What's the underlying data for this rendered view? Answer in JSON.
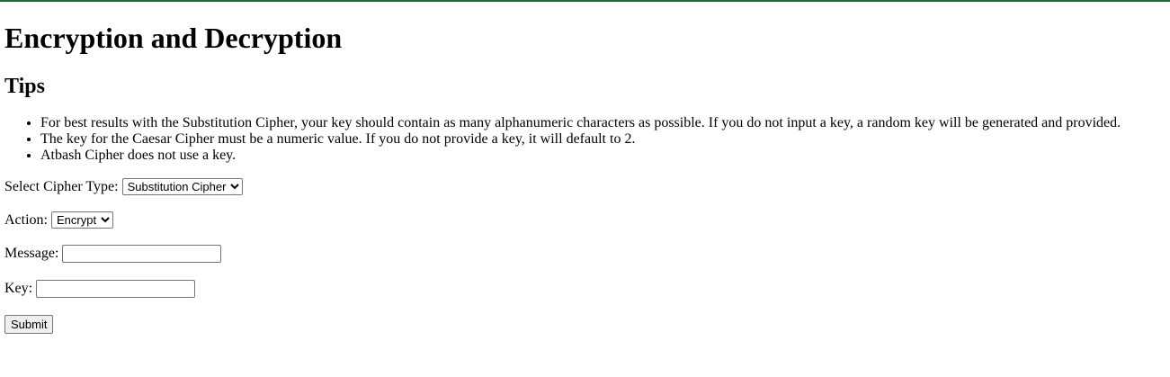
{
  "page": {
    "title": "Encryption and Decryption",
    "tips_heading": "Tips",
    "tips": [
      "For best results with the Substitution Cipher, your key should contain as many alphanumeric characters as possible. If you do not input a key, a random key will be generated and provided.",
      "The key for the Caesar Cipher must be a numeric value. If you do not provide a key, it will default to 2.",
      "Atbash Cipher does not use a key."
    ],
    "accent_color": "#1f6b3a"
  },
  "form": {
    "cipher_label": "Select Cipher Type:",
    "cipher_selected": "Substitution Cipher",
    "action_label": "Action:",
    "action_selected": "Encrypt",
    "message_label": "Message:",
    "message_value": "",
    "key_label": "Key:",
    "key_value": "",
    "submit_label": "Submit"
  }
}
